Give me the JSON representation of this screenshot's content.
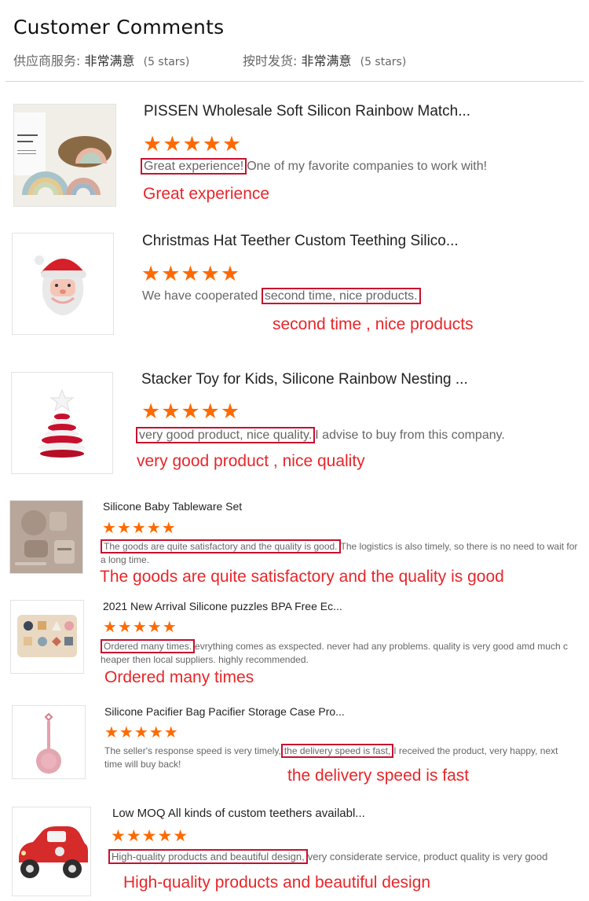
{
  "header": {
    "title": "Customer Comments",
    "supplier_label": "供应商服务:",
    "supplier_value": "非常满意",
    "supplier_stars": "(5 stars)",
    "shipping_label": "按时发货:",
    "shipping_value": "非常满意",
    "shipping_stars": "(5 stars)"
  },
  "stars": "★★★★★",
  "reviews": [
    {
      "product": "PISSEN Wholesale Soft Silicon Rainbow Match...",
      "highlight": "Great experience!",
      "rest": "One of my favorite companies to work with!",
      "caption": "Great experience"
    },
    {
      "product": "Christmas Hat Teether Custom Teething Silico...",
      "pre": "We have cooperated ",
      "highlight": "second time, nice products.",
      "caption": "second time , nice products"
    },
    {
      "product": "Stacker Toy for Kids, Silicone Rainbow Nesting ...",
      "highlight": "very good product,  nice quality.",
      "rest": "I advise to buy from this company.",
      "caption": "very good product , nice quality"
    },
    {
      "product": "Silicone Baby Tableware Set",
      "highlight": "The goods are quite satisfactory and the quality is good.",
      "rest": "The logistics is also timely, so there is no need to wait for a long time.",
      "caption": "The goods are quite satisfactory and the quality is good"
    },
    {
      "product": "2021 New Arrival Silicone puzzles BPA Free Ec...",
      "highlight": "Ordered many times.",
      "rest": "evrything comes as exspected. never had any problems. quality is very good amd much cheaper then local suppliers. highly recommended.",
      "caption": "Ordered many times"
    },
    {
      "product": "Silicone Pacifier Bag Pacifier Storage Case Pro...",
      "pre": "The seller's response speed is very timely,",
      "highlight": "the delivery speed is fast,",
      "rest": "I received the product, very happy, next time will buy back!",
      "caption": "the delivery speed is fast"
    },
    {
      "product": "Low MOQ All kinds of custom teethers availabl...",
      "highlight": "High-quality products and beautiful design,",
      "rest": "very considerate service, product quality is very good",
      "caption": "High-quality products and beautiful design"
    }
  ],
  "colors": {
    "star": "#ff6a00",
    "highlight_box": "#c8102e",
    "caption": "#e8262a"
  },
  "icons": [
    "rainbow-stacker-image",
    "santa-teether-image",
    "christmas-tree-stacker-image",
    "tableware-set-image",
    "puzzle-image",
    "pacifier-bag-image",
    "car-teether-image"
  ]
}
